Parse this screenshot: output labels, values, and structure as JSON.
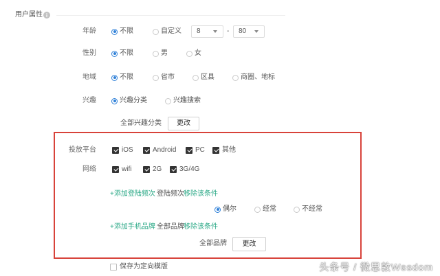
{
  "colors": {
    "radio_selected": "#2f80d8",
    "link": "#2aa886",
    "highlight_border": "#d8423a",
    "checkbox_checked": "#333333"
  },
  "icons": {
    "section_info": "info-icon",
    "select_arrow": "chevron-down-icon"
  },
  "section": {
    "title": "用户属性"
  },
  "age": {
    "label": "年龄",
    "options": [
      {
        "label": "不限",
        "selected": true
      },
      {
        "label": "自定义",
        "selected": false
      }
    ],
    "min": "8",
    "range_separator": "-",
    "max": "80"
  },
  "gender": {
    "label": "性别",
    "options": [
      {
        "label": "不限",
        "selected": true
      },
      {
        "label": "男",
        "selected": false
      },
      {
        "label": "女",
        "selected": false
      }
    ]
  },
  "region": {
    "label": "地域",
    "options": [
      {
        "label": "不限",
        "selected": true
      },
      {
        "label": "省市",
        "selected": false
      },
      {
        "label": "区县",
        "selected": false
      },
      {
        "label": "商圈、地标",
        "selected": false
      }
    ]
  },
  "interest": {
    "label": "兴趣",
    "options": [
      {
        "label": "兴趣分类",
        "selected": true
      },
      {
        "label": "兴趣搜索",
        "selected": false
      }
    ],
    "summary": "全部兴趣分类",
    "change_label": "更改"
  },
  "platform": {
    "label": "投放平台",
    "options": [
      {
        "label": "iOS",
        "checked": true
      },
      {
        "label": "Android",
        "checked": true
      },
      {
        "label": "PC",
        "checked": true
      },
      {
        "label": "其他",
        "checked": true
      }
    ]
  },
  "network": {
    "label": "网络",
    "options": [
      {
        "label": "wifi",
        "checked": true
      },
      {
        "label": "2G",
        "checked": true
      },
      {
        "label": "3G/4G",
        "checked": true
      }
    ]
  },
  "login_frequency": {
    "add_label": "+添加登陆频次",
    "name": "登陆频次",
    "remove_label": "移除该条件",
    "options": [
      {
        "label": "偶尔",
        "selected": true
      },
      {
        "label": "经常",
        "selected": false
      },
      {
        "label": "不经常",
        "selected": false
      }
    ]
  },
  "phone_brand": {
    "add_label": "+添加手机品牌",
    "name": "全部品牌",
    "remove_label": "移除该条件",
    "summary": "全部品牌",
    "change_label": "更改"
  },
  "save_template": {
    "label": "保存为定向模版",
    "checked": false
  },
  "watermark": {
    "text": "头条号 / 微思敦Wesdom"
  }
}
